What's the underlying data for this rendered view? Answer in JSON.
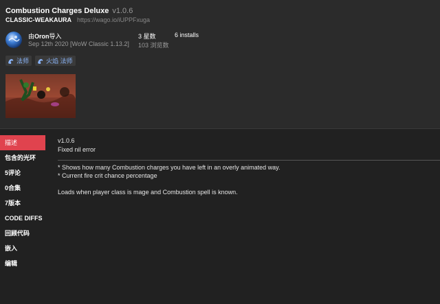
{
  "header": {
    "title": "Combustion Charges Deluxe",
    "version": "v1.0.6",
    "type_label": "CLASSIC-WEAKAURA",
    "url": "https://wago.io/iUPPFxuga",
    "author_prefix": "由",
    "author_name": "Oron",
    "author_suffix": "导入",
    "date": "Sep 12th 2020 [WoW Classic 1.13.2]",
    "stars": "3 星数",
    "installs": "6 installs",
    "views": "103 浏览数",
    "tags": [
      {
        "label": "法师",
        "icon": "fire-swirl-icon"
      },
      {
        "label": "火焰 法师",
        "icon": "fire-swirl-icon"
      }
    ]
  },
  "sidebar": {
    "items": [
      {
        "label": "描述",
        "active": true
      },
      {
        "label": "包含的光环"
      },
      {
        "label": "5评论"
      },
      {
        "label": "0合集"
      },
      {
        "label": "7版本"
      },
      {
        "label": "CODE DIFFS"
      },
      {
        "label": "回顾代码"
      },
      {
        "label": "嵌入"
      },
      {
        "label": "编辑"
      }
    ]
  },
  "content": {
    "changelog_version": "v1.0.6",
    "changelog_text": "Fixed nil error",
    "bullet1": "* Shows how many Combustion charges you have left in an overly animated way.",
    "bullet2": "* Current fire crit chance percentage",
    "paragraph": "Loads when player class is mage and Combustion spell is known."
  },
  "colors": {
    "accent": "#e0434e",
    "tag_text": "#8ab4f8",
    "page_bg": "#212121",
    "header_bg": "#2b2b2b"
  }
}
